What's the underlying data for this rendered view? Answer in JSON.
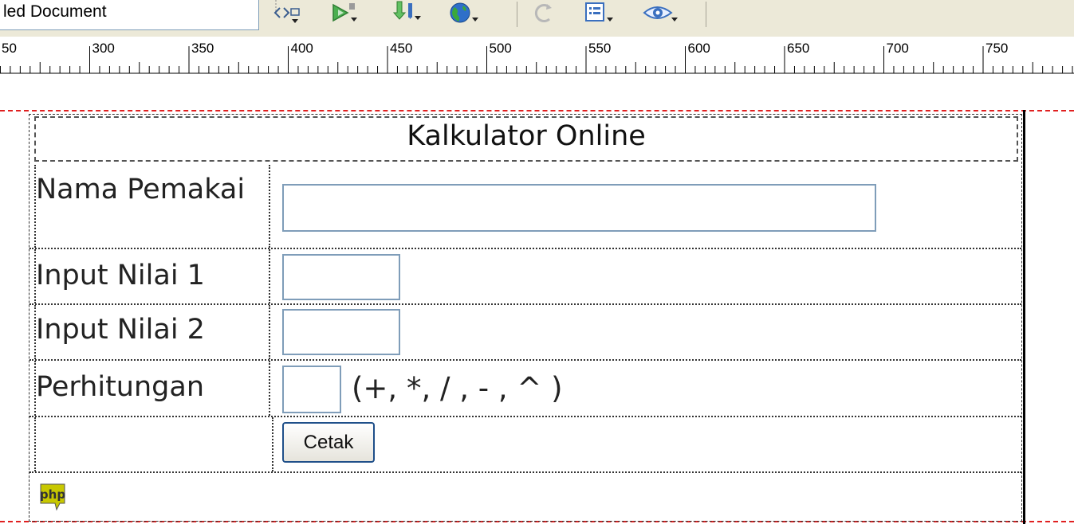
{
  "toolbar": {
    "document_title": "led Document",
    "icons": [
      "code-navigator-icon",
      "validate-icon",
      "file-management-icon",
      "preview-browser-icon",
      "refresh-icon",
      "view-options-icon",
      "visual-aids-icon"
    ]
  },
  "ruler": {
    "labels": [
      "50",
      "300",
      "350",
      "400",
      "450",
      "500",
      "550",
      "600",
      "650",
      "700",
      "750"
    ]
  },
  "form": {
    "title": "Kalkulator Online",
    "rows": [
      {
        "label": "Nama Pemakai",
        "value": ""
      },
      {
        "label": "Input Nilai 1",
        "value": ""
      },
      {
        "label": "Input Nilai 2",
        "value": ""
      },
      {
        "label": "Perhitungan",
        "value": "",
        "hint": "(+, *, / , - , ^ )"
      }
    ],
    "submit_label": "Cetak",
    "php_marker": "php"
  },
  "colors": {
    "guide_dash": "#e02020",
    "input_border": "#7f9db9",
    "toolbar_bg": "#ece9d8",
    "php_badge": "#c8c800"
  }
}
